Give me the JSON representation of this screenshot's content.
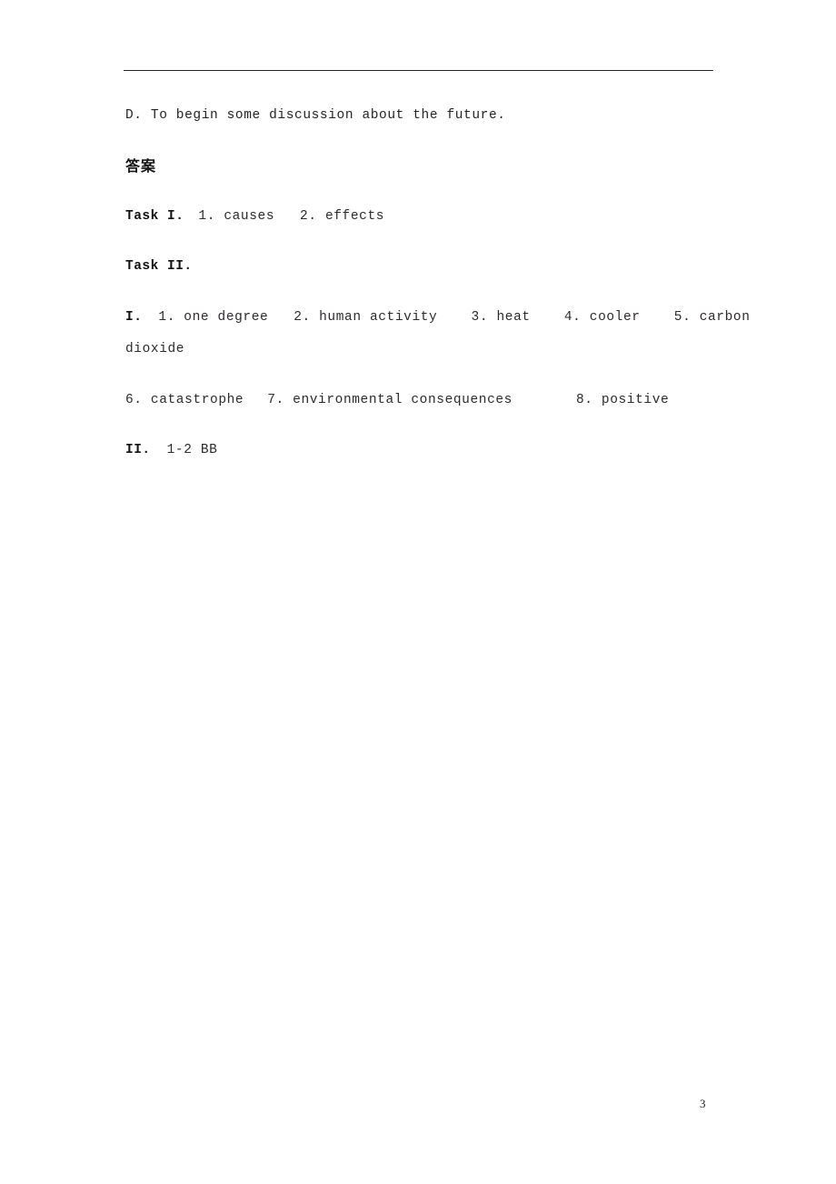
{
  "document": {
    "page_number": "3",
    "rule_color": "#2b2730",
    "text_color": "#262226",
    "background": "#ffffff"
  },
  "body": {
    "option_d": "D. To begin some discussion about the future.",
    "answer_heading": "答案",
    "task_1": {
      "label": "Task I.",
      "answers": "1. causes   2. effects"
    },
    "task_2": {
      "label": "Task II."
    },
    "section_i": {
      "label": "I.",
      "answers_line_1": "1. one degree   2. human activity    3. heat    4. cooler    5. carbon",
      "answers_line_2": "dioxide",
      "answers_line_3_a": "6. catastrophe",
      "answers_line_3_b": "7. environmental consequences",
      "answers_line_3_c": "8. positive"
    },
    "section_ii": {
      "label": "II.",
      "answers": "1-2 BB"
    }
  }
}
